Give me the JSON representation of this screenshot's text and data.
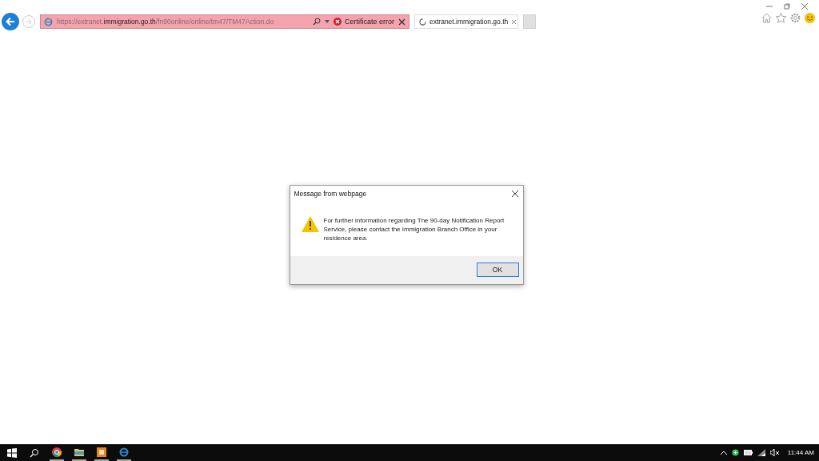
{
  "browser": {
    "url": "https://extranet.**immigration.go.th**/fn90online/online/tm47/TM47Action.do",
    "certificate_label": "Certificate error",
    "tabs": [
      {
        "title": "extranet.immigration.go.th",
        "selected": true
      }
    ]
  },
  "dialog": {
    "title": "Message from webpage",
    "message": " For further information regarding The 90-day Notification Report Service, please contact the Immigration Branch Office in your residence area.",
    "buttons": [
      "OK"
    ]
  },
  "taskbar": {
    "clock": "11:44 AM"
  }
}
